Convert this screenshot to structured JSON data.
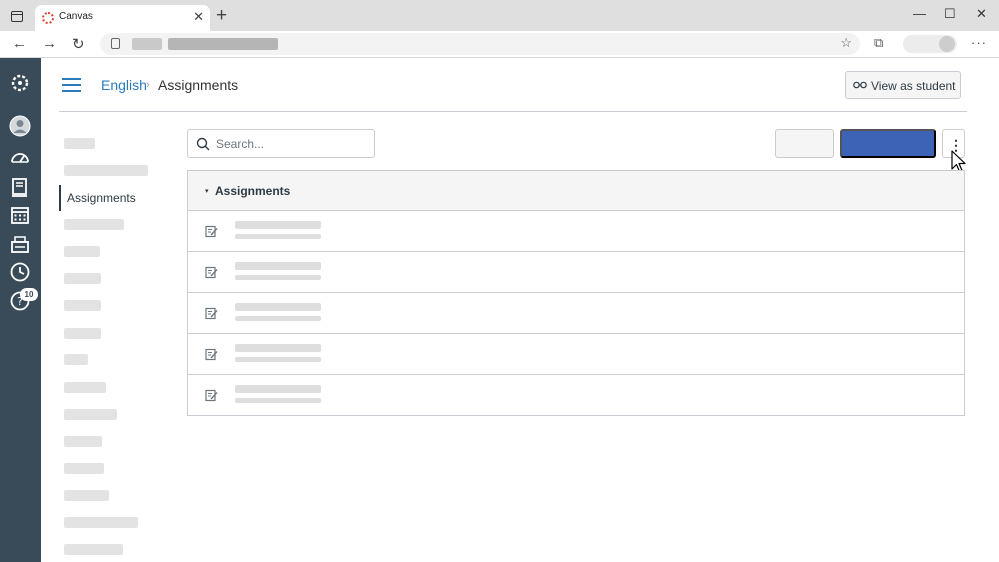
{
  "browser": {
    "tab_title": "Canvas",
    "tab_close": "✕",
    "new_tab": "+",
    "window_controls": {
      "minimize": "—",
      "maximize": "☐",
      "close": "✕"
    },
    "nav": {
      "back": "←",
      "forward": "→",
      "reload": "↻"
    },
    "favorites_icon": "☆",
    "collections_icon": "⧉",
    "menu": "···"
  },
  "global_nav": {
    "items": [
      "canvas-logo",
      "account",
      "dashboard",
      "courses",
      "calendar",
      "inbox",
      "history",
      "help"
    ],
    "help_badge": "10"
  },
  "header": {
    "course": "English",
    "separator": "›",
    "page": "Assignments",
    "view_as_student": "View as student"
  },
  "course_nav": {
    "active_item": "Assignments"
  },
  "toolbar": {
    "search_placeholder": "Search...",
    "kebab": "⋮"
  },
  "assignment_group": {
    "name": "Assignments",
    "caret": "▾",
    "row_count": 5
  }
}
